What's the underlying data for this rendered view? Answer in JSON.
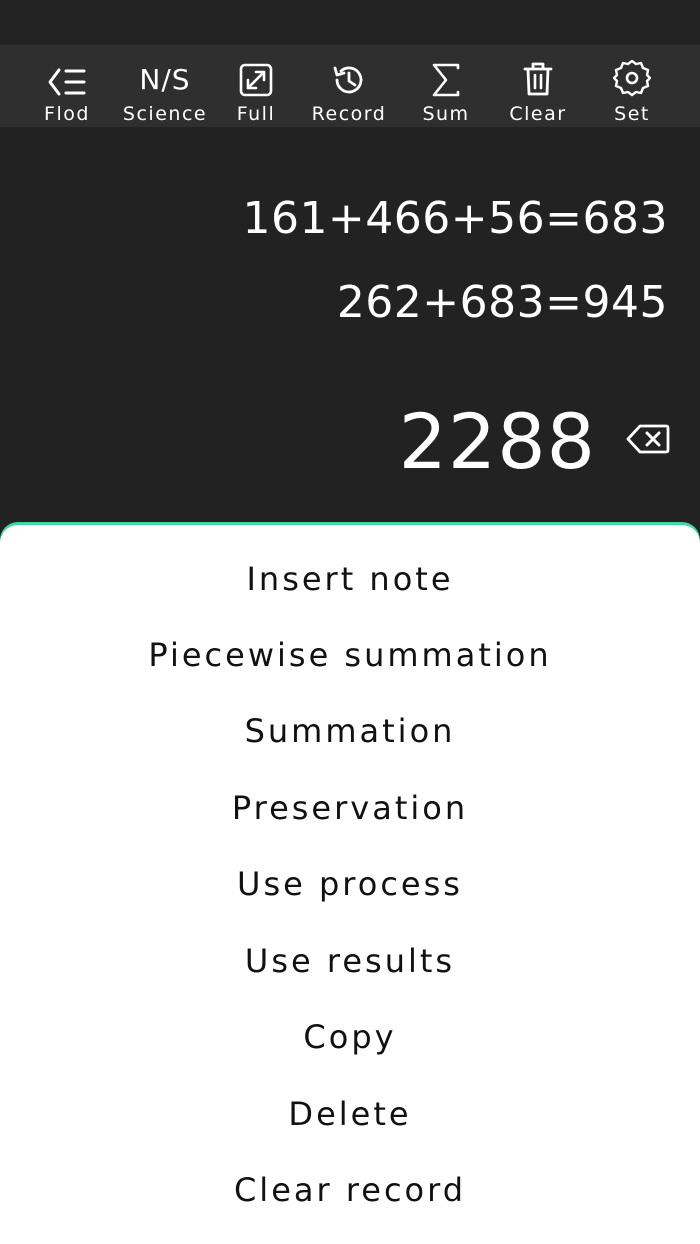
{
  "toolbar": {
    "items": [
      {
        "label": "Flod",
        "icon": "fold-list-icon"
      },
      {
        "label": "Science",
        "icon": "ns-text",
        "icon_text": "N/S"
      },
      {
        "label": "Full",
        "icon": "fullscreen-icon"
      },
      {
        "label": "Record",
        "icon": "history-icon"
      },
      {
        "label": "Sum",
        "icon": "sigma-icon"
      },
      {
        "label": "Clear",
        "icon": "trash-icon"
      },
      {
        "label": "Set",
        "icon": "gear-icon"
      }
    ]
  },
  "display": {
    "expressions": [
      "161+466+56=683",
      "262+683=945"
    ],
    "result": "2288"
  },
  "menu": {
    "items": [
      "Insert note",
      "Piecewise summation",
      "Summation",
      "Preservation",
      "Use process",
      "Use results",
      "Copy",
      "Delete",
      "Clear record"
    ]
  },
  "colors": {
    "background": "#222222",
    "toolbar": "#2f2f2f",
    "accent": "#3ed8a6",
    "sheet": "#ffffff"
  }
}
